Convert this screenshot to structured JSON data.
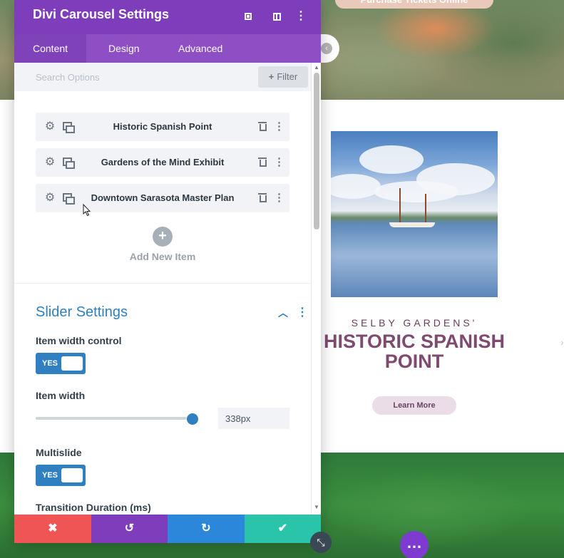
{
  "panel": {
    "title": "Divi Carousel Settings",
    "icons": [
      "expand-icon",
      "columns-icon",
      "more-options-icon"
    ],
    "tabs": [
      {
        "label": "Content",
        "active": true
      },
      {
        "label": "Design",
        "active": false
      },
      {
        "label": "Advanced",
        "active": false
      }
    ],
    "search": {
      "placeholder": "Search Options",
      "value": ""
    },
    "filter_label": "Filter"
  },
  "items": [
    {
      "label": "Historic Spanish Point"
    },
    {
      "label": "Gardens of the Mind Exhibit"
    },
    {
      "label": "Downtown Sarasota Master Plan"
    }
  ],
  "add_item_label": "Add New Item",
  "slider_settings": {
    "title": "Slider Settings",
    "item_width_control": {
      "label": "Item width control",
      "toggle": "YES",
      "on": true
    },
    "item_width": {
      "label": "Item width",
      "value": "338px",
      "slider_fraction": 0.96
    },
    "multislide": {
      "label": "Multislide",
      "toggle": "YES",
      "on": true
    },
    "transition_duration": {
      "label": "Transition Duration (ms)"
    }
  },
  "actions": [
    {
      "name": "discard",
      "glyph": "✖"
    },
    {
      "name": "undo",
      "glyph": "↺"
    },
    {
      "name": "redo",
      "glyph": "↻"
    },
    {
      "name": "save",
      "glyph": "✔"
    }
  ],
  "background": {
    "hero_button": "Purchase Tickets Online",
    "slide": {
      "subtitle": "SELBY GARDENS'",
      "title": "HISTORIC SPANISH POINT",
      "button": "Learn More"
    }
  },
  "colors": {
    "header": "#7e3dbb",
    "tabs": "#8e4fc5",
    "accent": "#2f7fc1",
    "discard": "#ef5555",
    "undo": "#7e3dbb",
    "redo": "#2b87da",
    "save": "#29c4a9"
  }
}
